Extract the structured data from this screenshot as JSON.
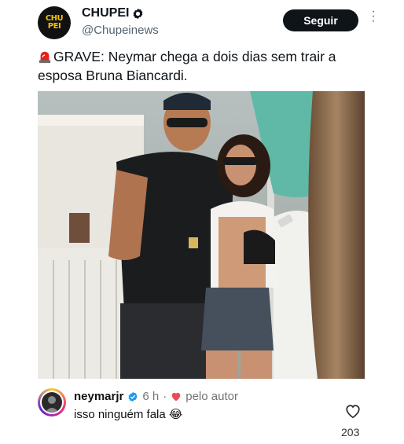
{
  "account": {
    "logo_text": "CHU PEI",
    "name": "CHUPEI",
    "handle": "@Chupeinews",
    "follow_label": "Seguir"
  },
  "tweet": {
    "text": "GRAVE: Neymar chega a dois dias sem trair a esposa Bruna Biancardi."
  },
  "reply": {
    "username": "neymarjr",
    "time": "6 h",
    "separator": "·",
    "liked_by": "pelo autor",
    "text": "isso ninguém fala 😂",
    "likes": "203"
  },
  "colors": {
    "follow_bg": "#0f1419",
    "logo_yellow": "#f2c200",
    "verified_blue": "#1d9bf0",
    "heart_red": "#ed4956"
  }
}
